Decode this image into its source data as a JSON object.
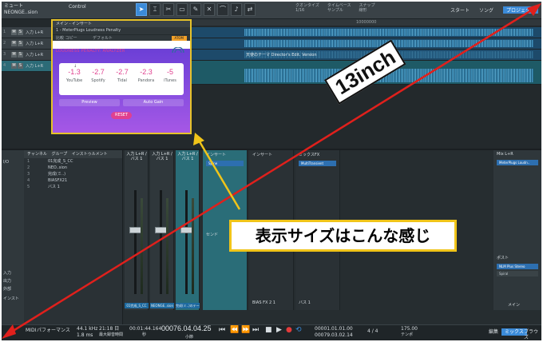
{
  "toolbar": {
    "song_title": "ミュート",
    "song_file": "NEONGE..sion",
    "control_label": "Control",
    "quantize_label": "クオンタイズ",
    "quantize_value": "1/16",
    "timebase_label": "タイムベース",
    "timebase_value": "サンプル",
    "snap_label": "スナップ",
    "snap_value": "線形",
    "start_label": "スタート",
    "song_label": "ソング",
    "project_label": "プロジェクト"
  },
  "ruler": {
    "ticks": [
      "10000000"
    ]
  },
  "tracks": [
    {
      "num": "1",
      "name": "入力 L+R",
      "color": "blue"
    },
    {
      "num": "2",
      "name": "入力 L+R",
      "color": "blue"
    },
    {
      "num": "3",
      "name": "入力 L+R",
      "color": "blue",
      "lane_label": "天使のテーマ Director's Edit. Version"
    },
    {
      "num": "4",
      "name": "入力 L+R",
      "color": "teal"
    }
  ],
  "plugin": {
    "window_title": "メイン - インサート",
    "plugin_name": "1 - MeterPlugs Loudness Penalty",
    "preset": "デフォルト",
    "row2": "比較 コピー",
    "atom": "ATOM",
    "heading": "LOUDNESS PENALTY: ANALYZER",
    "values": [
      {
        "value": "-1.3",
        "label": "YouTube"
      },
      {
        "value": "-2.7",
        "label": "Spotify"
      },
      {
        "value": "-2.7",
        "label": "Tidal"
      },
      {
        "value": "-2.3",
        "label": "Pandora"
      },
      {
        "value": "-5",
        "label": "iTunes"
      }
    ],
    "preview_label": "Preview",
    "autogain_label": "Auto Gain",
    "reset_label": "RESET"
  },
  "mixer": {
    "left_items": [
      "I/O",
      "入力",
      "出力",
      "外部",
      "インスト"
    ],
    "list_header_channel": "チャンネル",
    "list_header_group": "グループ",
    "list_header_inst": "インストゥルメント",
    "list_items": [
      {
        "idx": "1",
        "name": "01完成_S_CC"
      },
      {
        "idx": "2",
        "name": "NEO..sion"
      },
      {
        "idx": "3",
        "name": "完成(ミ..)"
      },
      {
        "idx": "4",
        "name": "BIASFX21"
      },
      {
        "idx": "5",
        "name": "バス 1"
      }
    ],
    "strips": [
      {
        "in": "入力 L+R / バス 1",
        "name": "01完成_S_CC"
      },
      {
        "in": "入力 L+R / バス 1",
        "name": "NEONGE..sion"
      },
      {
        "in": "入力 L+R / バス 1",
        "name": "完成(ミ..)のテーマ_MIX_CD"
      }
    ],
    "fx": [
      {
        "title": "インサート",
        "slots": [
          "Spine"
        ]
      },
      {
        "title": "ミックスFX",
        "slots": [
          "MultiTransient"
        ]
      }
    ],
    "send_label": "センド",
    "bias_label": "BIAS FX 2 1",
    "bus_label": "バス 1",
    "main_label": "メイン",
    "main_input": "Mix L+R",
    "main_slots": [
      "MeterPlugs Loudn..",
      "NLM Plus Stereo",
      "Spiral"
    ],
    "post_label": "ポスト"
  },
  "transport": {
    "midi": "MIDI",
    "performance": "パフォーマンス",
    "sample_rate": "44.1 kHz",
    "latency": "1.8 ms",
    "duration": "21:18 日",
    "duration_label": "最大録音時間",
    "time": "00:01:44.164",
    "time_label": "秒",
    "bars": "00076.04.04.25",
    "bars_label": "小節",
    "loop_start": "00001.01.01.00",
    "loop_end": "00079.03.02.14",
    "signature": "4 / 4",
    "tempo": "175.00",
    "tempo_label": "テンポ",
    "tab_edit": "編集",
    "tab_mix": "ミックス",
    "tab_browse": "ブラウズ"
  },
  "annotations": {
    "diagonal_label": "13inch",
    "size_label": "表示サイズはこんな感じ"
  },
  "colors": {
    "highlight_border": "#f0c419",
    "annotation_line": "#e0201c",
    "penalty_value": "#e0408f",
    "plugin_gradient": "#8a4fe0"
  }
}
